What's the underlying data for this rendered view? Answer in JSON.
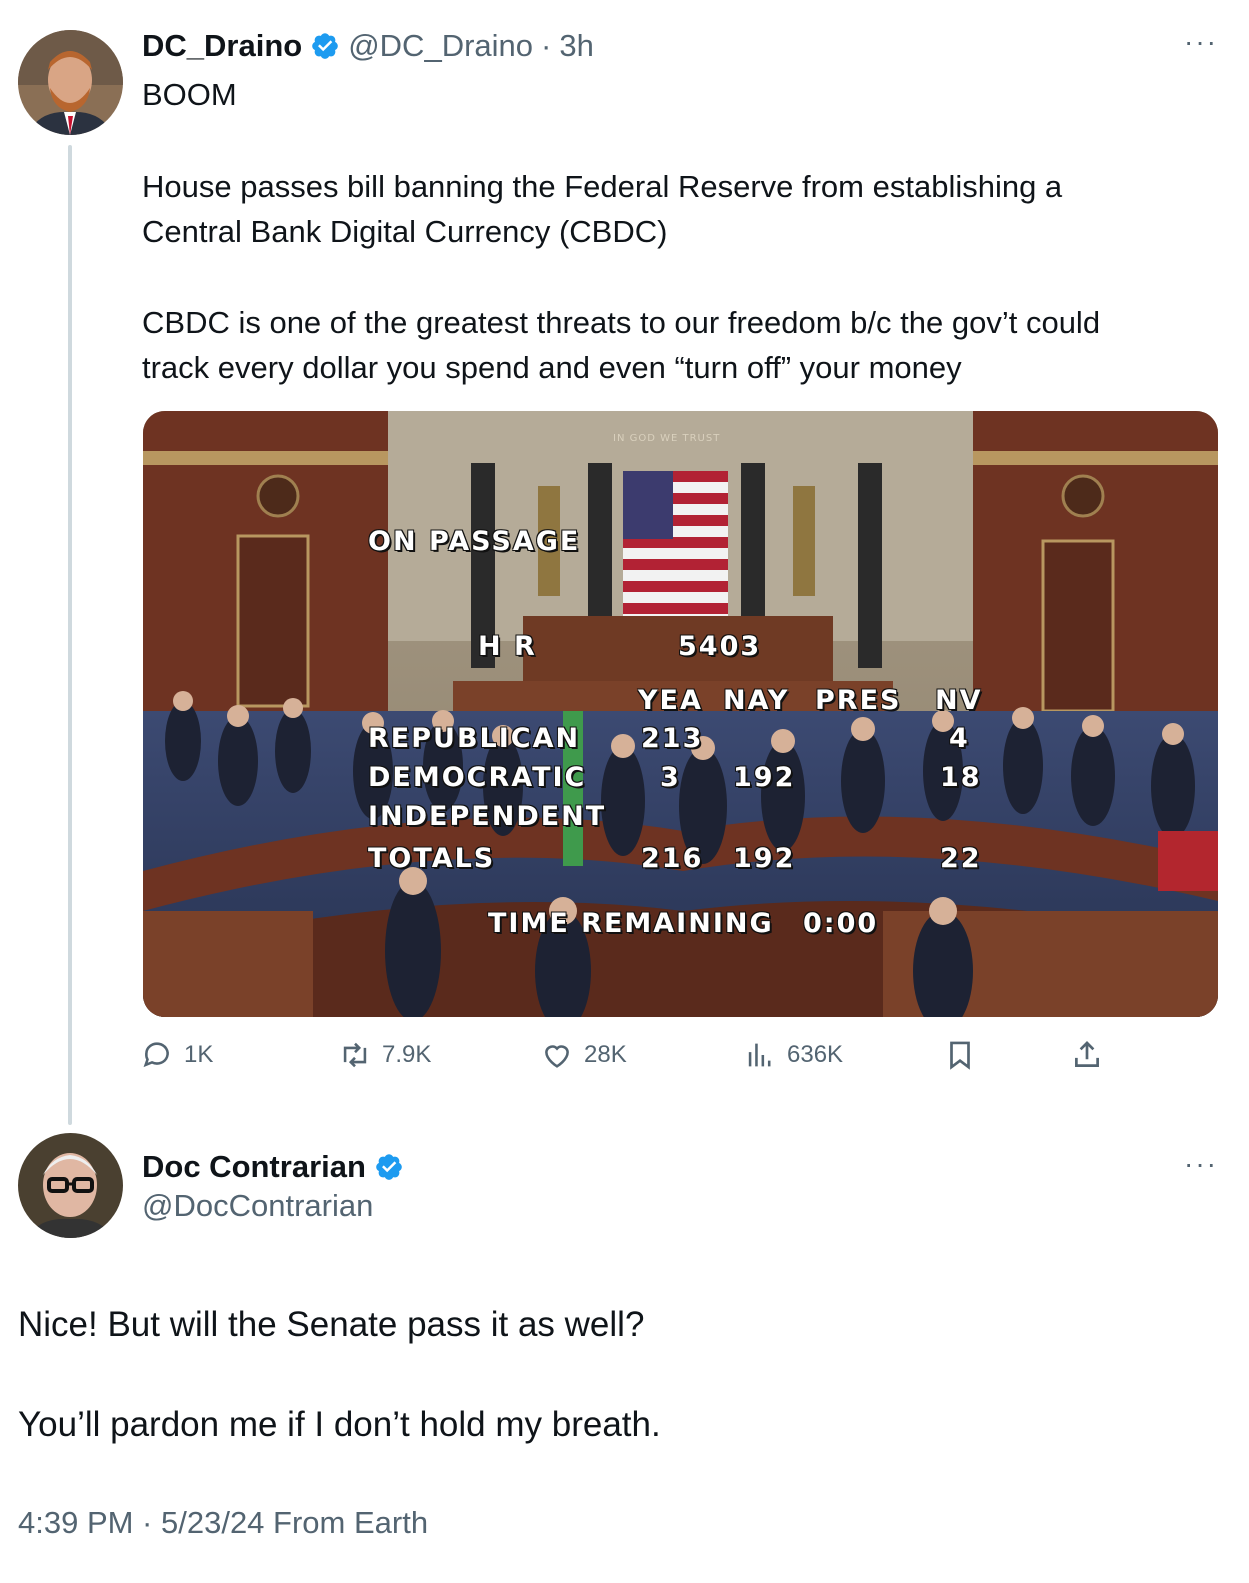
{
  "tweet": {
    "author_name": "DC_Draino",
    "author_handle": "@DC_Draino",
    "time_sep": "·",
    "time": "3h",
    "more": "···",
    "line1": "BOOM",
    "para1_line1": "House passes bill banning the Federal Reserve from establishing a",
    "para1_line2": "Central Bank Digital Currency (CBDC)",
    "para2_line1": "CBDC is one of the greatest threats to our freedom b/c the gov’t could",
    "para2_line2": "track every dollar you spend and even “turn off” your money",
    "media": {
      "motto": "IN GOD WE TRUST",
      "on_passage": "ON PASSAGE",
      "hr": "H R",
      "bill": "5403",
      "col_yea": "YEA",
      "col_nay": "NAY",
      "col_pres": "PRES",
      "col_nv": "NV",
      "row_rep": "REPUBLICAN",
      "row_dem": "DEMOCRATIC",
      "row_ind": "INDEPENDENT",
      "row_tot": "TOTALS",
      "rep_yea": "213",
      "rep_nv": "4",
      "dem_yea": "3",
      "dem_nay": "192",
      "dem_nv": "18",
      "tot_yea": "216",
      "tot_nay": "192",
      "tot_nv": "22",
      "time_label": "TIME REMAINING",
      "time_value": "0:00"
    },
    "actions": {
      "replies": "1K",
      "reposts": "7.9K",
      "likes": "28K",
      "views": "636K"
    }
  },
  "reply": {
    "author_name": "Doc Contrarian",
    "author_handle": "@DocContrarian",
    "more": "···",
    "line1": "Nice! But will the Senate pass it as well?",
    "line2": "You’ll pardon me if I don’t hold my breath.",
    "timestamp": "4:39 PM · 5/23/24 From Earth"
  },
  "colors": {
    "verified": "#1d9bf0",
    "secondary_text": "#536471",
    "thread_line": "#cfd9de"
  }
}
